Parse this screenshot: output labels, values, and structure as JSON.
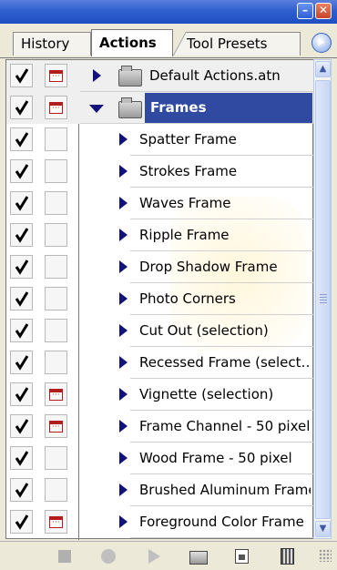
{
  "tabs": {
    "history": "History",
    "actions": "Actions",
    "tool_presets": "Tool Presets"
  },
  "window_controls": {
    "minimize_glyph": "–",
    "close_glyph": "✕",
    "panel_menu_glyph": "▶"
  },
  "sets": [
    {
      "label": "Default Actions.atn",
      "toggle_glyph": "✔",
      "expanded": false
    },
    {
      "label": "Frames",
      "toggle_glyph": "✔",
      "expanded": true
    }
  ],
  "actions": [
    {
      "label": "Spatter Frame",
      "check": "✔",
      "dialog": false
    },
    {
      "label": "Strokes Frame",
      "check": "✔",
      "dialog": false
    },
    {
      "label": "Waves Frame",
      "check": "✔",
      "dialog": false
    },
    {
      "label": "Ripple Frame",
      "check": "✔",
      "dialog": false
    },
    {
      "label": "Drop Shadow Frame",
      "check": "✔",
      "dialog": false
    },
    {
      "label": "Photo Corners",
      "check": "✔",
      "dialog": false
    },
    {
      "label": "Cut Out (selection)",
      "check": "✔",
      "dialog": false
    },
    {
      "label": "Recessed Frame (select…",
      "check": "✔",
      "dialog": false
    },
    {
      "label": "Vignette (selection)",
      "check": "✔",
      "dialog": true
    },
    {
      "label": "Frame Channel - 50 pixel",
      "check": "✔",
      "dialog": true
    },
    {
      "label": "Wood Frame - 50 pixel",
      "check": "✔",
      "dialog": false
    },
    {
      "label": "Brushed Aluminum Frame",
      "check": "✔",
      "dialog": false
    },
    {
      "label": "Foreground Color Frame",
      "check": "✔",
      "dialog": true
    }
  ],
  "scrollbar": {
    "up_glyph": "▲",
    "down_glyph": "▼"
  },
  "toolbar": [
    "stop-icon",
    "record-icon",
    "play-icon",
    "new-set-icon",
    "new-action-icon",
    "trash-icon"
  ],
  "colors": {
    "selection": "#2f4aa0",
    "dialog_icon": "#b11d1d",
    "triangle": "#12127a",
    "titlebar": "#2f5fcf"
  }
}
